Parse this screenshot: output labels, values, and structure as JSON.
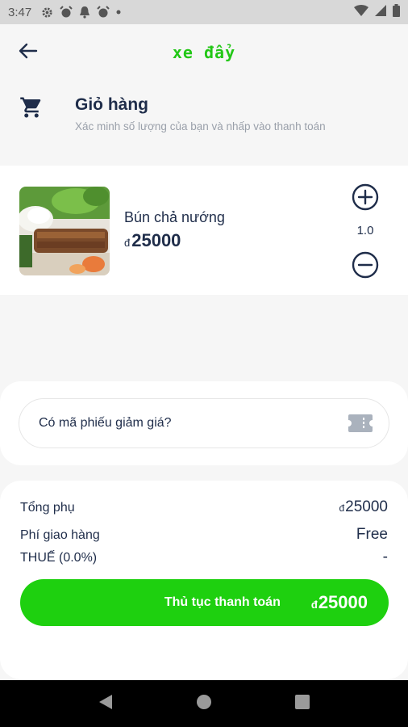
{
  "status_bar": {
    "time": "3:47",
    "icons": [
      "settings-icon",
      "alarm-icon",
      "notification-icon",
      "alarm-icon",
      "dot-icon"
    ],
    "right_icons": [
      "wifi-icon",
      "signal-icon",
      "battery-icon"
    ]
  },
  "app_bar": {
    "title": "xe đẩy",
    "back_icon": "arrow-left-icon"
  },
  "cart": {
    "icon": "shopping-cart-icon",
    "title": "Giỏ hàng",
    "subtitle": "Xác minh số lượng của bạn và nhấp vào thanh toán"
  },
  "items": [
    {
      "name": "Bún chả nướng",
      "currency": "đ",
      "price": "25000",
      "quantity": "1.0"
    }
  ],
  "coupon": {
    "label": "Có mã phiếu giảm giá?",
    "icon": "ticket-icon"
  },
  "summary": {
    "subtotal_label": "Tổng phụ",
    "subtotal_currency": "đ",
    "subtotal_value": "25000",
    "delivery_label": "Phí giao hàng",
    "delivery_value": "Free",
    "tax_label": "THUẾ (0.0%)",
    "tax_value": "-"
  },
  "checkout": {
    "label": "Thủ tục thanh toán",
    "currency": "đ",
    "amount": "25000"
  },
  "colors": {
    "accent": "#1ed00f",
    "title_green": "#22c716",
    "text_dark": "#1f2d4a"
  },
  "nav_bar": [
    "back-triangle-icon",
    "home-circle-icon",
    "recents-square-icon"
  ]
}
